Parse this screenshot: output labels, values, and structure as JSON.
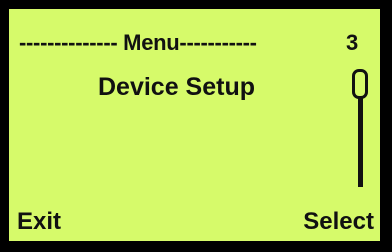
{
  "screen": {
    "header_text": "-------------- Menu-----------",
    "page_number": "3",
    "selected_item": "Device Setup"
  },
  "softkeys": {
    "left_label": "Exit",
    "right_label": "Select"
  },
  "scroll": {
    "position_fraction": 0.0
  },
  "colors": {
    "lcd_background": "#d6fa6a",
    "text": "#111111",
    "bezel": "#000000"
  }
}
